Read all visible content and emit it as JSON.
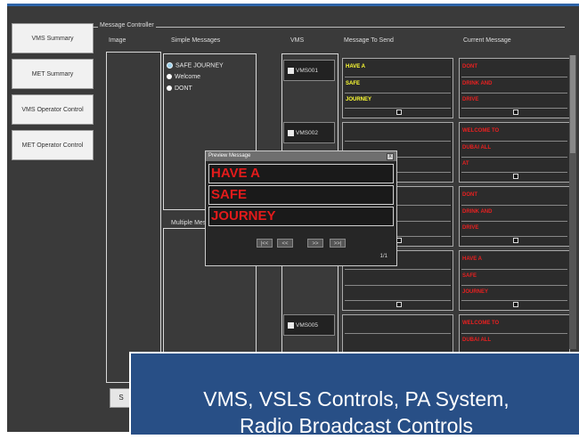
{
  "sidebar": {
    "items": [
      {
        "label": "VMS Summary"
      },
      {
        "label": "MET Summary"
      },
      {
        "label": "VMS Operator Control"
      },
      {
        "label": "MET Operator Control"
      }
    ]
  },
  "panel": {
    "legend": "Message Controller",
    "headers": {
      "image": "Image",
      "simple": "Simple Messages",
      "multiple": "Multiple Messages",
      "vms": "VMS",
      "to_send": "Message To Send",
      "current": "Current Message"
    },
    "simple_messages": [
      "SAFE JOURNEY",
      "Welcome",
      "DONT"
    ],
    "vms_units": [
      "VMS001",
      "VMS002",
      "VMS005"
    ],
    "send_rows": [
      [
        "HAVE A",
        "SAFE",
        "JOURNEY"
      ]
    ],
    "current_rows": [
      [
        "DONT",
        "DRINK AND",
        "DRIVE"
      ],
      [
        "WELCOME TO",
        "DUBAI ALL",
        "AT"
      ],
      [
        "DONT",
        "DRINK AND",
        "DRIVE"
      ],
      [
        "HAVE A",
        "SAFE",
        "JOURNEY"
      ],
      [
        "WELCOME TO",
        "DUBAI ALL"
      ]
    ],
    "save_label": "S"
  },
  "preview": {
    "title": "Preview Message",
    "close": "X",
    "lines": [
      "HAVE A",
      "SAFE",
      "JOURNEY"
    ],
    "pager": {
      "first": "|<<",
      "prev": "<<",
      "next": ">>",
      "last": ">>|",
      "count": "1/1"
    }
  },
  "overlay": {
    "line1": "VMS, VSLS Controls, PA System,",
    "line2": "Radio Broadcast Controls"
  },
  "colors": {
    "send_text": "#ffff33",
    "current_text": "#e82020",
    "preview_text": "#e31b1b",
    "overlay_bg": "#284f86"
  }
}
